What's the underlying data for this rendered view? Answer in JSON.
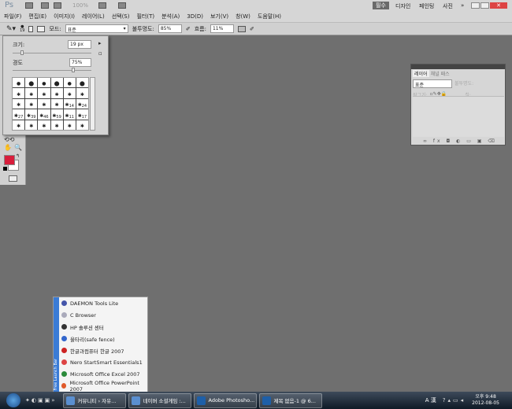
{
  "app": {
    "logo": "Ps",
    "zoom": "100%"
  },
  "workspaces": {
    "active": "필수",
    "items": [
      "디자인",
      "페인팅",
      "사진"
    ],
    "more": "»"
  },
  "menu": [
    "파일(F)",
    "편집(E)",
    "이미지(I)",
    "레이어(L)",
    "선택(S)",
    "필터(T)",
    "분석(A)",
    "3D(D)",
    "보기(V)",
    "창(W)",
    "도움말(H)"
  ],
  "options": {
    "brush_size": "19",
    "mode_label": "모드:",
    "mode_value": "표준",
    "opacity_label": "불투명도:",
    "opacity_value": "85%",
    "flow_label": "흐름:",
    "flow_value": "11%"
  },
  "brush_popup": {
    "size_label": "크기:",
    "size_value": "19 px",
    "hardness_label": "경도",
    "hardness_value": "75%",
    "size_slider": 0.1,
    "hardness_slider": 0.75,
    "labels": [
      "",
      "",
      "",
      "",
      "",
      "",
      "",
      "",
      "",
      "",
      "",
      "",
      "",
      "",
      "",
      "",
      "14",
      "24",
      "27",
      "39",
      "46",
      "59",
      "11",
      "17",
      "",
      "",
      "",
      "",
      "",
      ""
    ]
  },
  "colors": {
    "foreground": "#d81e3c",
    "background": "#ffffff"
  },
  "layers_panel": {
    "tabs": [
      "레이어",
      "채널",
      "패스"
    ],
    "blend": "표준",
    "opacity_label": "불투명도:",
    "lock_label": "잠그기:",
    "fill_label": "칠:"
  },
  "launch_bar": {
    "title": "Free Launch Bar",
    "items": [
      {
        "label": "DAEMON Tools Lite",
        "color": "#4455aa"
      },
      {
        "label": "C Browser",
        "color": "#aab"
      },
      {
        "label": "HP 솔루션 센터",
        "color": "#333"
      },
      {
        "label": "울타리(safe fence)",
        "color": "#3366cc"
      },
      {
        "label": "한글과컴퓨터 한글 2007",
        "color": "#cc2222"
      },
      {
        "label": "Nero StartSmart Essentials1",
        "color": "#dd4444"
      },
      {
        "label": "Microsoft Office Excel 2007",
        "color": "#2a8a3a"
      },
      {
        "label": "Microsoft Office PowerPoint 2007",
        "color": "#e05a2a"
      }
    ]
  },
  "taskbar": {
    "tasks": [
      {
        "label": "커뮤니티 › 자유...",
        "icon": "chrome-icon"
      },
      {
        "label": "네이버 소셜게임 :...",
        "icon": "chrome-icon"
      },
      {
        "label": "Adobe Photosho...",
        "icon": "photoshop-icon"
      },
      {
        "label": "제목 없음-1 @ 6...",
        "icon": "photoshop-icon"
      }
    ],
    "ime": "A 漢",
    "time": "오후 9:48",
    "date": "2012-08-05"
  }
}
